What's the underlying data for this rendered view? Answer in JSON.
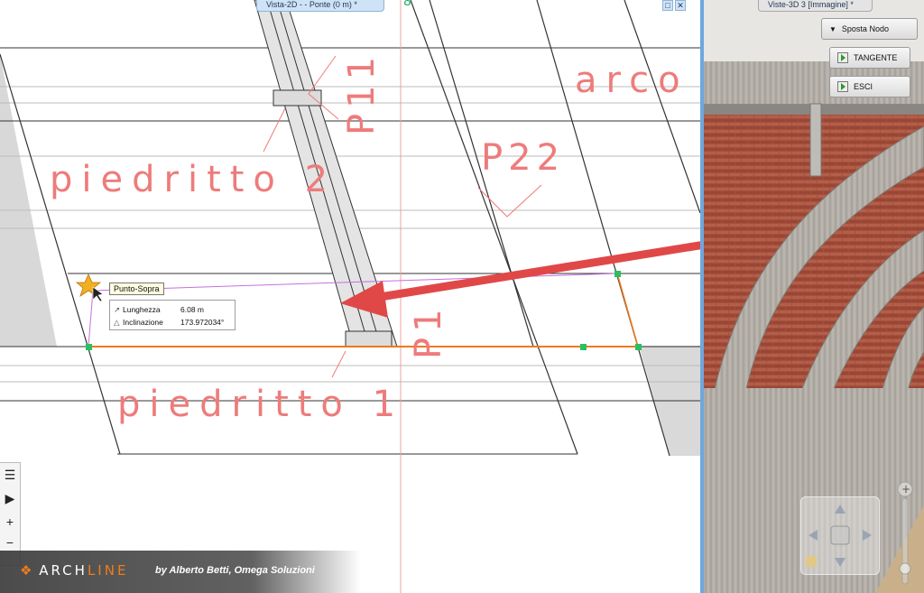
{
  "view2d": {
    "tab_title": "Vista-2D -  - Ponte (0 m) *",
    "win_buttons": [
      "□",
      "✕"
    ],
    "labels": {
      "arco": "arco",
      "piedritto2": "piedritto 2",
      "piedritto1": "piedritto 1",
      "p11": "P11",
      "p22": "P22",
      "p1": "P1",
      "axis_mark": "8"
    },
    "snap_tooltip": "Punto-Sopra",
    "measure": {
      "length_label": "Lunghezza",
      "length_value": "6.08 m",
      "incline_label": "Inclinazione",
      "incline_value": "173.972034°"
    },
    "colors": {
      "annotation": "#ee7b7b",
      "selection": "#f07818",
      "rubberband": "#c86ee0",
      "arrow": "#e04848",
      "node": "#28c060"
    }
  },
  "view3d": {
    "tab_title": "Viste-3D 3 [Immagine] *",
    "move_node_label": "Sposta Nodo",
    "tangent_label": "TANGENTE",
    "exit_label": "ESCI"
  },
  "left_panel": {
    "items": [
      "list-icon",
      "play-icon",
      "plus-icon",
      "minus-icon"
    ]
  },
  "branding": {
    "logo_text_a": "ARCH",
    "logo_text_b": "LINE",
    "byline": "by Alberto Betti, Omega Soluzioni"
  }
}
